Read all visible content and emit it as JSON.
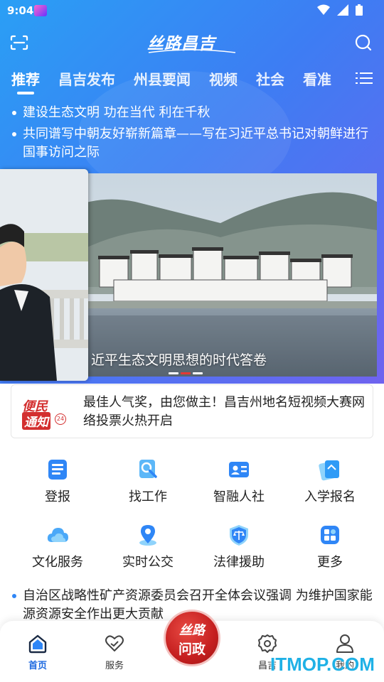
{
  "status_bar": {
    "time": "9:04"
  },
  "header": {
    "logo_text": "丝路昌吉"
  },
  "tabs": [
    {
      "label": "推荐",
      "active": true
    },
    {
      "label": "昌吉发布"
    },
    {
      "label": "州县要闻"
    },
    {
      "label": "视频"
    },
    {
      "label": "社会"
    },
    {
      "label": "看准"
    }
  ],
  "headlines": [
    "建设生态文明 功在当代 利在千秋",
    "共同谱写中朝友好崭新篇章——写在习近平总书记对朝鲜进行国事访问之际"
  ],
  "carousel": {
    "caption": "近平生态文明思想的时代答卷",
    "slide_count": 3,
    "active_index": 1
  },
  "notice": {
    "badge_line1": "便民",
    "badge_line2": "通知",
    "badge_num": "24",
    "text": "最佳人气奖，由您做主！昌吉州地名短视频大赛网络投票火热开启"
  },
  "services": [
    {
      "label": "登报",
      "icon": "newspaper-icon"
    },
    {
      "label": "找工作",
      "icon": "job-search-icon"
    },
    {
      "label": "智融人社",
      "icon": "id-card-icon"
    },
    {
      "label": "入学报名",
      "icon": "enrollment-icon"
    },
    {
      "label": "文化服务",
      "icon": "cloud-icon"
    },
    {
      "label": "实时公交",
      "icon": "location-pin-icon"
    },
    {
      "label": "法律援助",
      "icon": "scales-icon"
    },
    {
      "label": "更多",
      "icon": "more-grid-icon"
    }
  ],
  "bottom_news": "自治区战略性矿产资源委员会召开全体会议强调 为维护国家能源资源安全作出更大贡献",
  "bottom_nav": {
    "home": "首页",
    "service": "服务",
    "center_line1": "丝路",
    "center_line2": "问政",
    "changji": "昌吉",
    "mine": "我的"
  },
  "watermark": "ITMOP.COM",
  "colors": {
    "accent": "#2f86f6",
    "nav_active": "#1e6ae0",
    "center_red": "#c51f1f"
  }
}
